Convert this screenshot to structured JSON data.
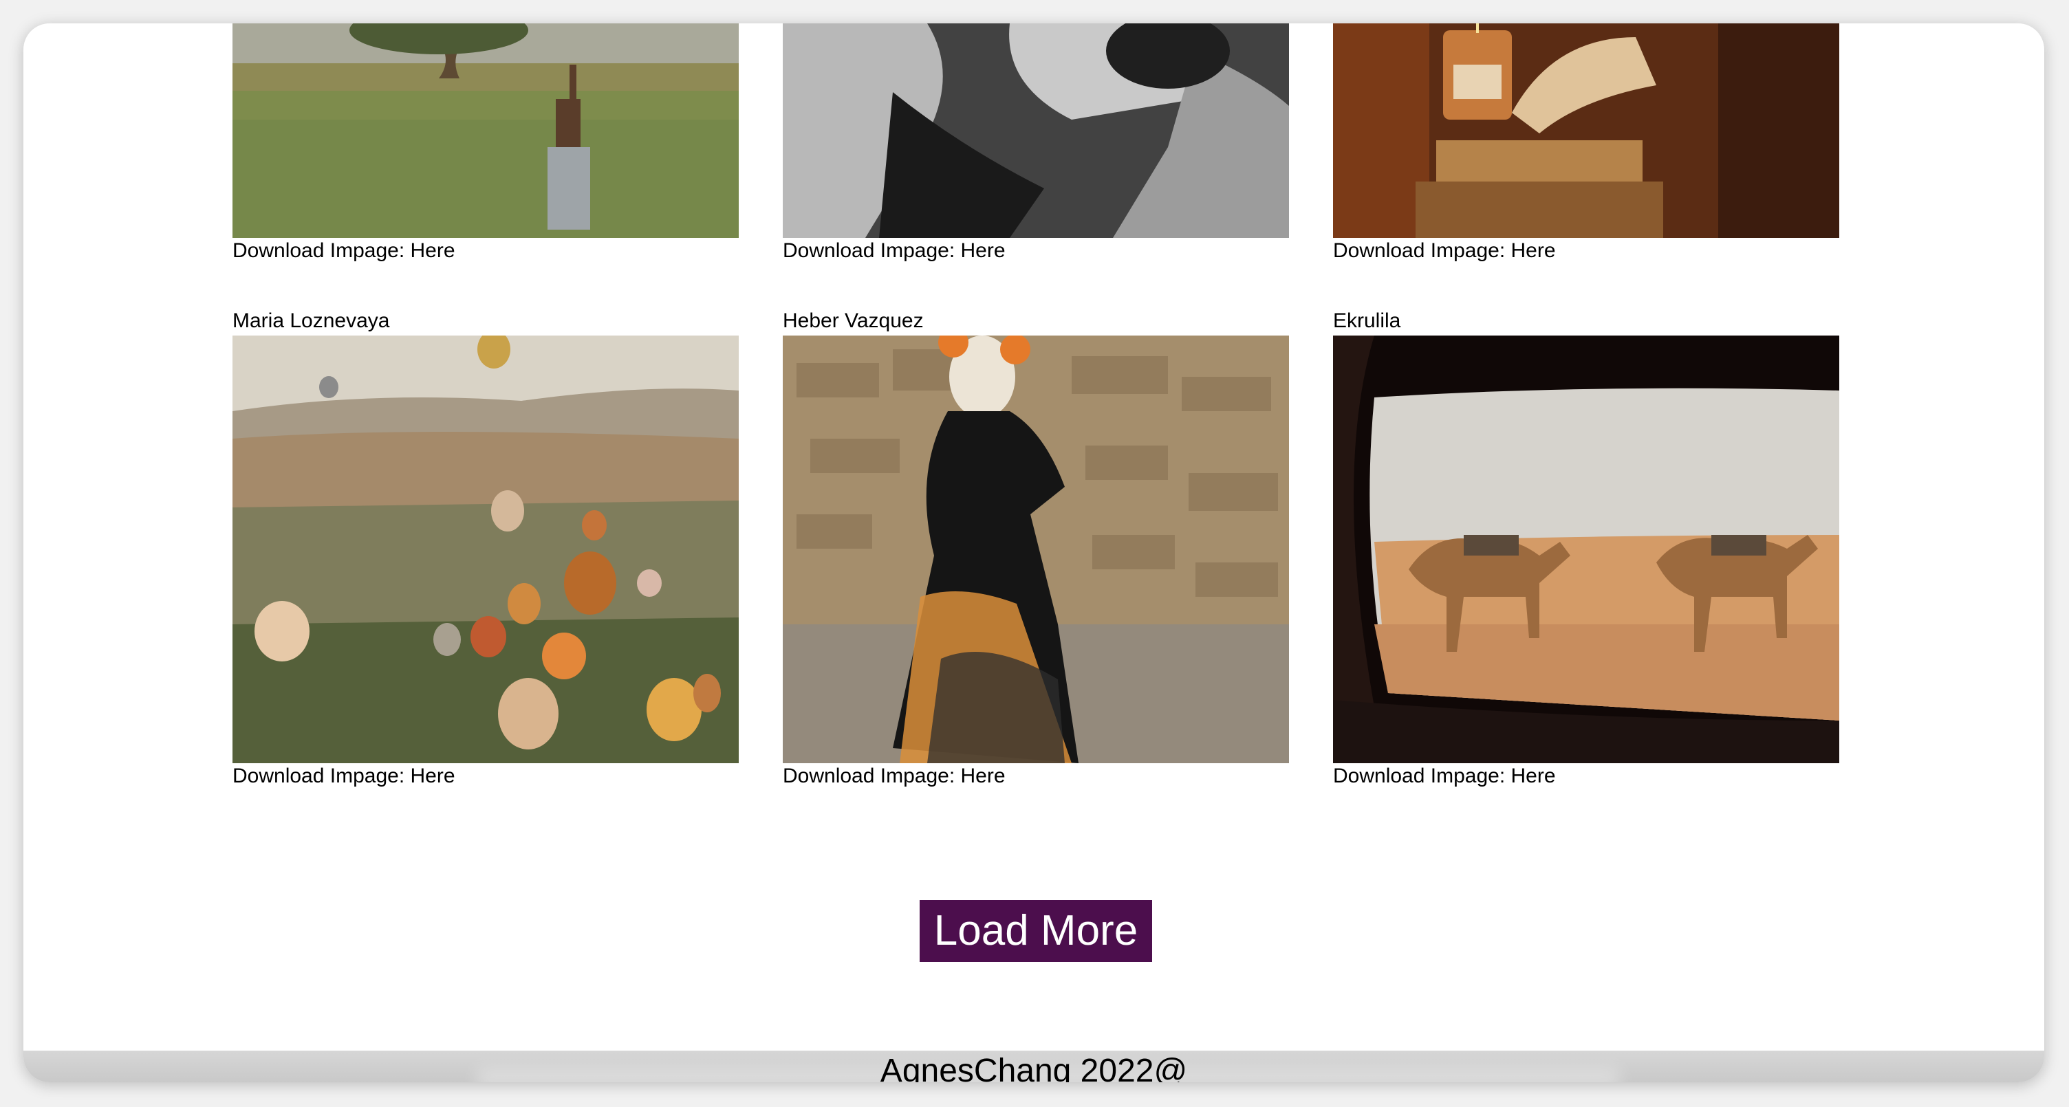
{
  "gallery": {
    "row1": [
      {
        "author": "",
        "download_prefix": "Download Impage: ",
        "download_link": "Here",
        "image": "man-dancing-in-field-photo"
      },
      {
        "author": "",
        "download_prefix": "Download Impage: ",
        "download_link": "Here",
        "image": "woman-resting-bw-photo"
      },
      {
        "author": "",
        "download_prefix": "Download Impage: ",
        "download_link": "Here",
        "image": "candle-and-books-photo"
      }
    ],
    "row2": [
      {
        "author": "Maria Loznevaya",
        "download_prefix": "Download Impage: ",
        "download_link": "Here",
        "image": "hot-air-balloons-photo"
      },
      {
        "author": "Heber Vazquez",
        "download_prefix": "Download Impage: ",
        "download_link": "Here",
        "image": "catrina-costume-photo"
      },
      {
        "author": "Ekrulila",
        "download_prefix": "Download Impage: ",
        "download_link": "Here",
        "image": "camels-through-car-window-photo"
      }
    ]
  },
  "load_more": {
    "label": "Load More",
    "color": "#4c0e4d"
  },
  "footer": {
    "credit": "AgnesChang 2022@"
  }
}
